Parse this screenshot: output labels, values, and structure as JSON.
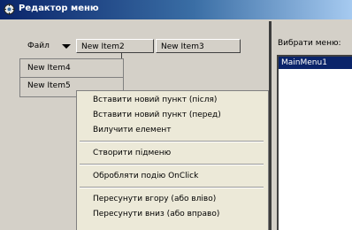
{
  "window": {
    "title": "Редактор меню",
    "colors": {
      "titlebar": "#0a246a",
      "face": "#d4d0c8",
      "selection": "#0a246a"
    }
  },
  "menubar": {
    "file_label": "Файл",
    "item2_label": "New Item2",
    "item3_label": "New Item3"
  },
  "submenu": {
    "items": [
      "New Item4",
      "New Item5"
    ]
  },
  "context_menu": {
    "insert_after": "Вставити новий пункт (після)",
    "insert_before": "Вставити новий пункт (перед)",
    "delete": "Вилучити елемент",
    "create_submenu": "Створити підменю",
    "handle_onclick": "Обробляти подію OnClick",
    "move_up": "Пересунути вгору (або вліво)",
    "move_down": "Пересунути вниз (або вправо)"
  },
  "right_panel": {
    "label": "Вибрати меню:",
    "list": [
      "MainMenu1"
    ]
  }
}
